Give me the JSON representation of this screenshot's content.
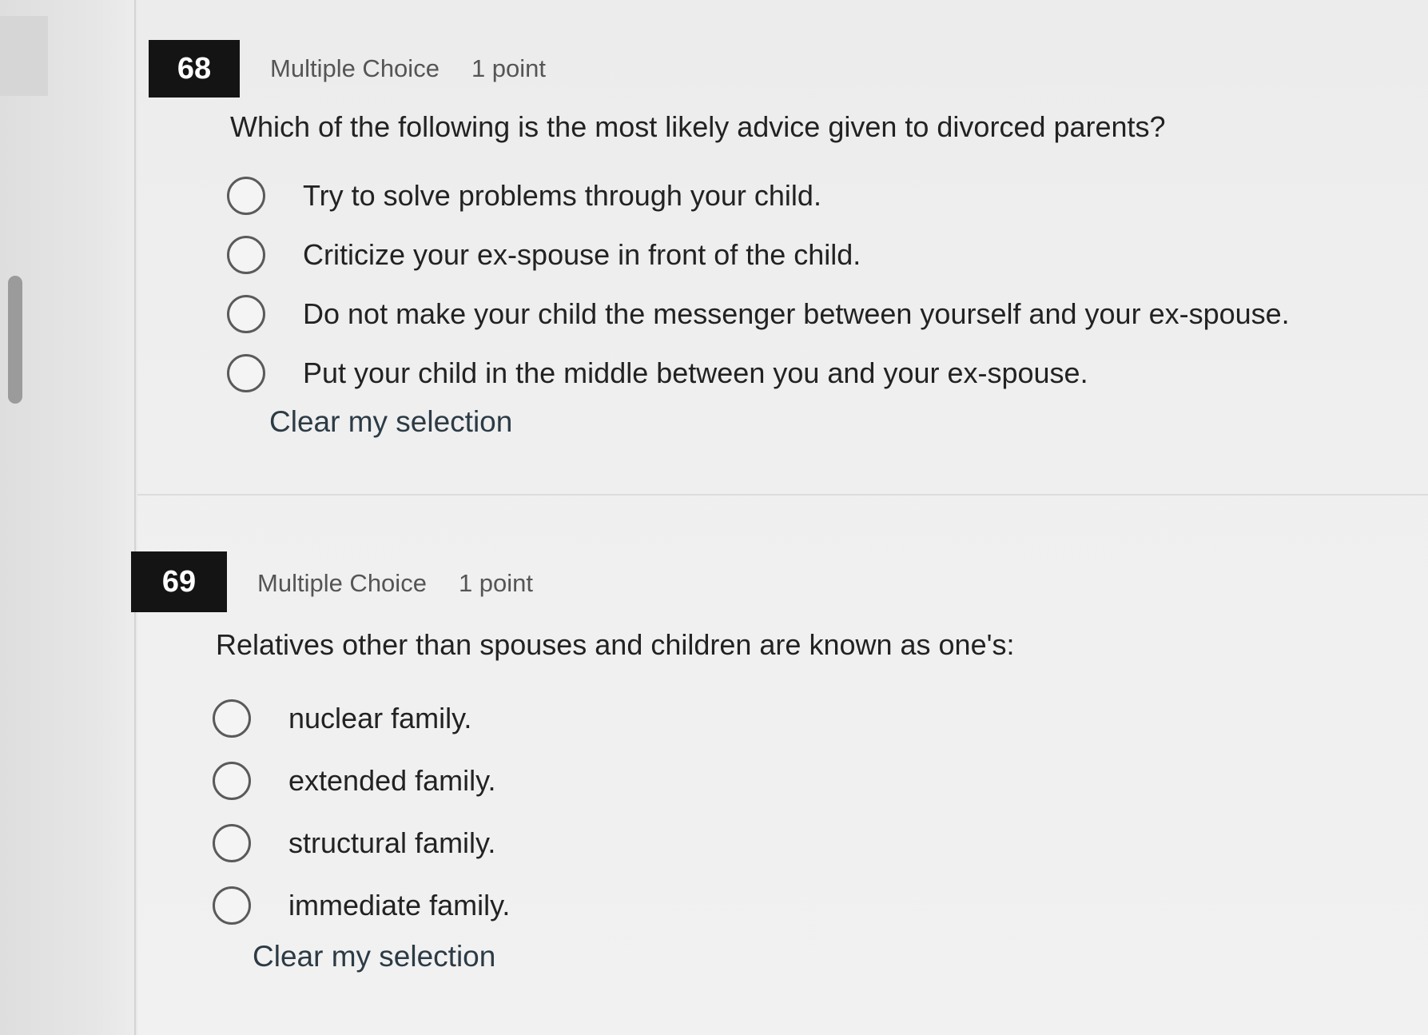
{
  "questions": [
    {
      "number": "68",
      "type": "Multiple Choice",
      "points": "1 point",
      "stem": "Which of the following is the most likely advice given to divorced parents?",
      "options": [
        "Try to solve problems through your child.",
        "Criticize your ex-spouse in front of the child.",
        "Do not make your child the messenger between yourself and your ex-spouse.",
        "Put your child in the middle between you and your ex-spouse."
      ],
      "clear_label": "Clear my selection"
    },
    {
      "number": "69",
      "type": "Multiple Choice",
      "points": "1 point",
      "stem": "Relatives other than spouses and children are known as one's:",
      "options": [
        "nuclear family.",
        "extended family.",
        "structural family.",
        "immediate family."
      ],
      "clear_label": "Clear my selection"
    }
  ]
}
